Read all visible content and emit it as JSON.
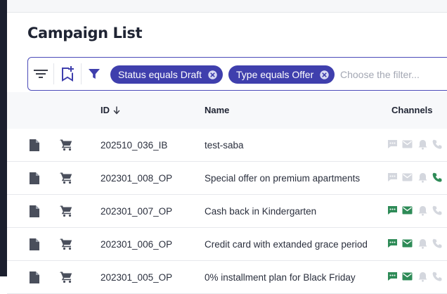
{
  "page": {
    "title": "Campaign List"
  },
  "filter_bar": {
    "chips": [
      {
        "label": "Status equals Draft"
      },
      {
        "label": "Type equals Offer"
      }
    ],
    "placeholder": "Choose the filter..."
  },
  "table": {
    "columns": {
      "id": "ID",
      "name": "Name",
      "channels": "Channels"
    },
    "rows": [
      {
        "id": "202510_036_IB",
        "name": "test-saba",
        "channels": {
          "sms": false,
          "email": false,
          "push": false,
          "call": false
        }
      },
      {
        "id": "202301_008_OP",
        "name": "Special offer on premium apartments",
        "channels": {
          "sms": false,
          "email": false,
          "push": false,
          "call": true
        }
      },
      {
        "id": "202301_007_OP",
        "name": "Cash back in Kindergarten",
        "channels": {
          "sms": true,
          "email": true,
          "push": false,
          "call": false
        }
      },
      {
        "id": "202301_006_OP",
        "name": "Credit card with extanded grace period",
        "channels": {
          "sms": true,
          "email": true,
          "push": false,
          "call": false
        }
      },
      {
        "id": "202301_005_OP",
        "name": "0% installment plan for Black Friday",
        "channels": {
          "sms": true,
          "email": true,
          "push": false,
          "call": false
        }
      }
    ]
  },
  "colors": {
    "accent": "#3f3fad",
    "channel_active": "#2e8b57",
    "channel_inactive": "#d4d7de",
    "icon": "#4a4f5c"
  },
  "icons": {
    "row_doc": "document-icon",
    "row_cart": "cart-icon",
    "channels": [
      "sms-icon",
      "email-icon",
      "bell-icon",
      "phone-icon"
    ]
  }
}
